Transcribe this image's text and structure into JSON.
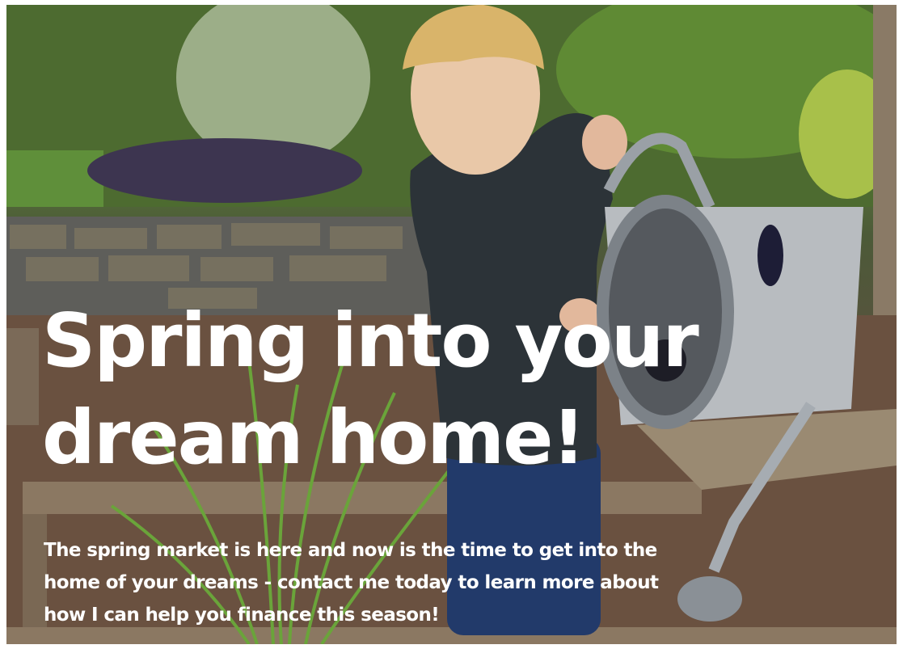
{
  "promo": {
    "headline_line1": "Spring into your",
    "headline_line2": "dream home!",
    "body_line1": "The spring market is here and now is the time to get into the",
    "body_line2": "home of your dreams - contact me today to learn more about",
    "body_line3": "how I can help you finance this season!"
  },
  "colors": {
    "headline_text": "#ffffff",
    "body_text": "#ffffff"
  }
}
